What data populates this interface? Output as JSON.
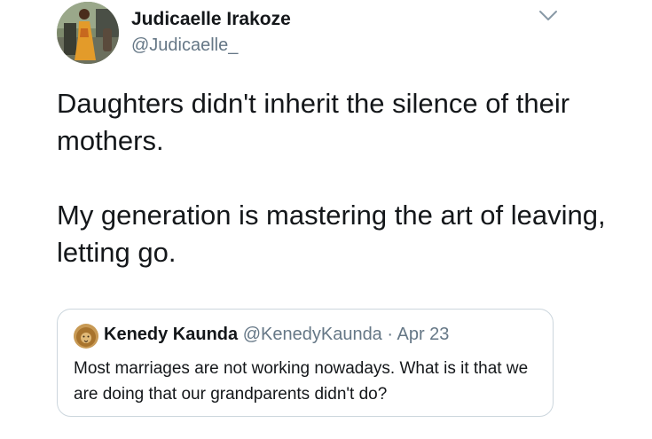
{
  "author": {
    "name": "Judicaelle Irakoze",
    "handle": "@Judicaelle_"
  },
  "tweet": {
    "paragraph_1": "Daughters didn't inherit the silence of their mothers.",
    "paragraph_2": "My generation is mastering the art of leaving, letting go."
  },
  "quoted_tweet": {
    "name": "Kenedy Kaunda",
    "handle": "@KenedyKaunda",
    "separator": " · ",
    "date": "Apr 23",
    "text": "Most marriages are not working nowadays. What is it that we are doing that our grandparents didn't do?"
  },
  "icons": {
    "more_menu": "chevron-down-icon"
  },
  "colors": {
    "text": "#14171a",
    "secondary_text": "#657786",
    "quote_border": "#ccd6dd"
  }
}
